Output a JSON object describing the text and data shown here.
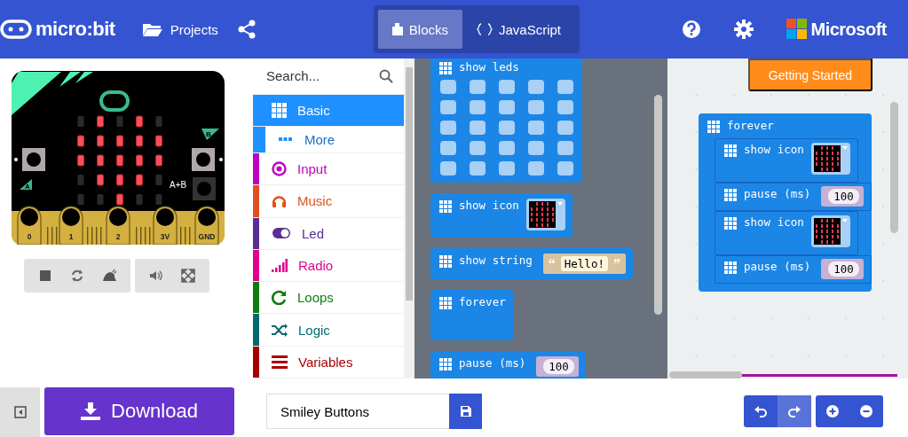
{
  "header": {
    "logo_text": "micro:bit",
    "projects": "Projects",
    "tabs": [
      {
        "label": "Blocks",
        "selected": true
      },
      {
        "label": "JavaScript",
        "selected": false
      }
    ],
    "brand": "Microsoft"
  },
  "simulator": {
    "leds": [
      [
        false,
        true,
        false,
        true,
        false
      ],
      [
        true,
        true,
        true,
        true,
        true
      ],
      [
        true,
        true,
        true,
        true,
        true
      ],
      [
        false,
        true,
        true,
        true,
        false
      ],
      [
        false,
        false,
        true,
        false,
        false
      ]
    ],
    "button_labels": [
      "A",
      "B",
      "A+B"
    ],
    "pins": [
      "0",
      "1",
      "2",
      "3V",
      "GND"
    ]
  },
  "toolbox": {
    "search": {
      "placeholder": "Search..."
    },
    "categories": [
      {
        "label": "Basic",
        "kind": "category",
        "color": "#1e90ff",
        "selected": true
      },
      {
        "label": "More",
        "kind": "subcategory",
        "color": "#1e90ff",
        "selected": false
      },
      {
        "label": "Input",
        "kind": "category",
        "color": "#c000c0",
        "selected": false
      },
      {
        "label": "Music",
        "kind": "category",
        "color": "#e0501c",
        "selected": false
      },
      {
        "label": "Led",
        "kind": "category",
        "color": "#5c2d91",
        "selected": false
      },
      {
        "label": "Radio",
        "kind": "category",
        "color": "#e3008c",
        "selected": false
      },
      {
        "label": "Loops",
        "kind": "category",
        "color": "#107c10",
        "selected": false
      },
      {
        "label": "Logic",
        "kind": "category",
        "color": "#006970",
        "selected": false
      },
      {
        "label": "Variables",
        "kind": "category",
        "color": "#a80000",
        "selected": false
      }
    ]
  },
  "flyout": {
    "blocks": [
      {
        "kind": "show_leds",
        "label": "show leds"
      },
      {
        "kind": "show_icon",
        "label": "show icon"
      },
      {
        "kind": "show_string",
        "label": "show string",
        "open_quote": "“",
        "value": "Hello!",
        "close_quote": "”"
      },
      {
        "kind": "forever",
        "label": "forever"
      },
      {
        "kind": "pause",
        "label": "pause (ms)",
        "value": "100"
      }
    ]
  },
  "workspace": {
    "getting_started": "Getting Started",
    "blocks": [
      {
        "kind": "forever",
        "label": "forever",
        "children": [
          {
            "kind": "show_icon",
            "label": "show icon"
          },
          {
            "kind": "pause",
            "label": "pause (ms)",
            "value": "100"
          },
          {
            "kind": "show_icon",
            "label": "show icon"
          },
          {
            "kind": "pause",
            "label": "pause (ms)",
            "value": "100"
          }
        ]
      }
    ]
  },
  "footer": {
    "download": "Download",
    "project_name": "Smiley Buttons"
  }
}
